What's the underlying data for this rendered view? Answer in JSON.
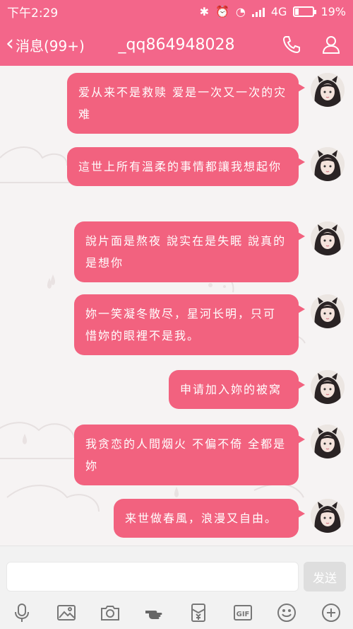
{
  "status_bar": {
    "time": "下午2:29",
    "network": "4G",
    "battery": "19%",
    "battery_level": 0.19
  },
  "nav": {
    "back_label": "消息(99+)",
    "title": "_qq864948028",
    "icons": [
      "phone-icon",
      "profile-icon"
    ]
  },
  "colors": {
    "accent": "#f3668a",
    "bubble": "#f2627f"
  },
  "messages": [
    {
      "text": "爱从来不是救赎 爱是一次又一次的灾难"
    },
    {
      "text": "這世上所有溫柔的事情都讓我想起你"
    },
    {
      "text": "說片面是熬夜 說实在是失眠 說真的是想你"
    },
    {
      "text": "妳一笑凝冬散尽，星河长明，只可惜妳的眼裡不是我。"
    },
    {
      "text": "申请加入妳的被窝"
    },
    {
      "text": "我贪恋的人間烟火 不偏不倚 全都是妳"
    },
    {
      "text": "来世做春風，浪漫又自由。"
    }
  ],
  "input": {
    "send_label": "发送"
  },
  "toolbar": {
    "icons": [
      "microphone-icon",
      "image-icon",
      "camera-icon",
      "poke-hand-icon",
      "red-packet-icon",
      "gif-icon",
      "emoji-icon",
      "more-plus-icon"
    ]
  }
}
